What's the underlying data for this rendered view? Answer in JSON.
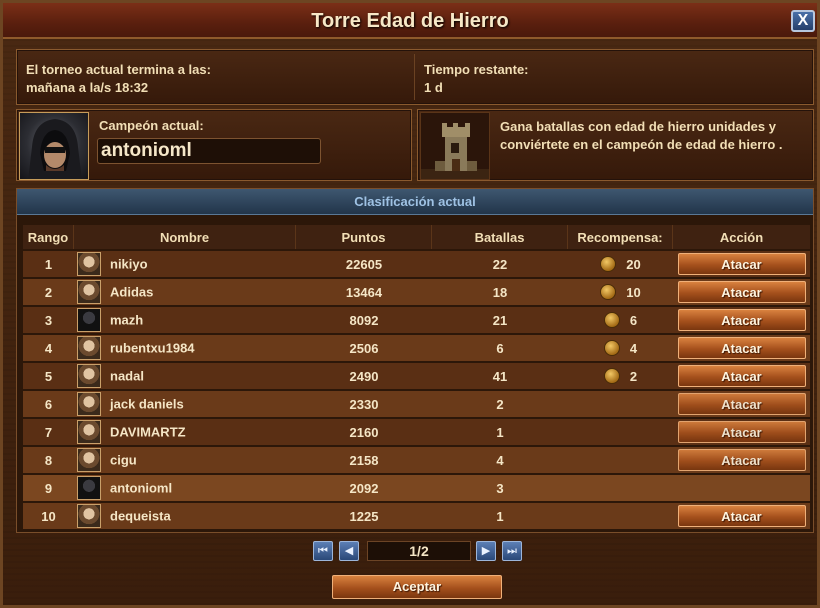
{
  "window": {
    "title": "Torre Edad de Hierro",
    "close_label": "X"
  },
  "info": {
    "ends_label": "El torneo actual termina a las:",
    "ends_value": "mañana a la/s 18:32",
    "remaining_label": "Tiempo restante:",
    "remaining_value": "1 d"
  },
  "champion": {
    "label": "Campeón actual:",
    "name": "antonioml"
  },
  "goal": {
    "text": "Gana batallas con edad de hierro unidades y conviértete en el campeón de edad de hierro ."
  },
  "ranking": {
    "header": "Clasificación actual",
    "columns": [
      "Rango",
      "Nombre",
      "Puntos",
      "Batallas",
      "Recompensa:",
      "Acción"
    ],
    "rows": [
      {
        "rank": "1",
        "name": "nikiyo",
        "points": "22605",
        "battles": "22",
        "reward": "20",
        "action": "Atacar"
      },
      {
        "rank": "2",
        "name": "Adidas",
        "points": "13464",
        "battles": "18",
        "reward": "10",
        "action": "Atacar"
      },
      {
        "rank": "3",
        "name": "mazh",
        "points": "8092",
        "battles": "21",
        "reward": "6",
        "action": "Atacar"
      },
      {
        "rank": "4",
        "name": "rubentxu1984",
        "points": "2506",
        "battles": "6",
        "reward": "4",
        "action": "Atacar"
      },
      {
        "rank": "5",
        "name": "nadal",
        "points": "2490",
        "battles": "41",
        "reward": "2",
        "action": "Atacar"
      },
      {
        "rank": "6",
        "name": "jack daniels",
        "points": "2330",
        "battles": "2",
        "reward": "",
        "action": "Atacar"
      },
      {
        "rank": "7",
        "name": "DAVIMARTZ",
        "points": "2160",
        "battles": "1",
        "reward": "",
        "action": "Atacar"
      },
      {
        "rank": "8",
        "name": "cigu",
        "points": "2158",
        "battles": "4",
        "reward": "",
        "action": "Atacar"
      },
      {
        "rank": "9",
        "name": "antonioml",
        "points": "2092",
        "battles": "3",
        "reward": "",
        "action": ""
      },
      {
        "rank": "10",
        "name": "dequeista",
        "points": "1225",
        "battles": "1",
        "reward": "",
        "action": "Atacar"
      }
    ]
  },
  "pager": {
    "first": "⏮",
    "prev": "◀",
    "label": "1/2",
    "next": "▶",
    "last": "⏭"
  },
  "footer": {
    "accept_label": "Aceptar"
  },
  "icons": {
    "champion_portrait": "hooded-figure-portrait",
    "goal": "tower-icon",
    "reward": "medal-icon"
  },
  "colors": {
    "title_bar": "#5a1f0e",
    "ranking_header": "#22354a",
    "button": "#a5501c"
  }
}
